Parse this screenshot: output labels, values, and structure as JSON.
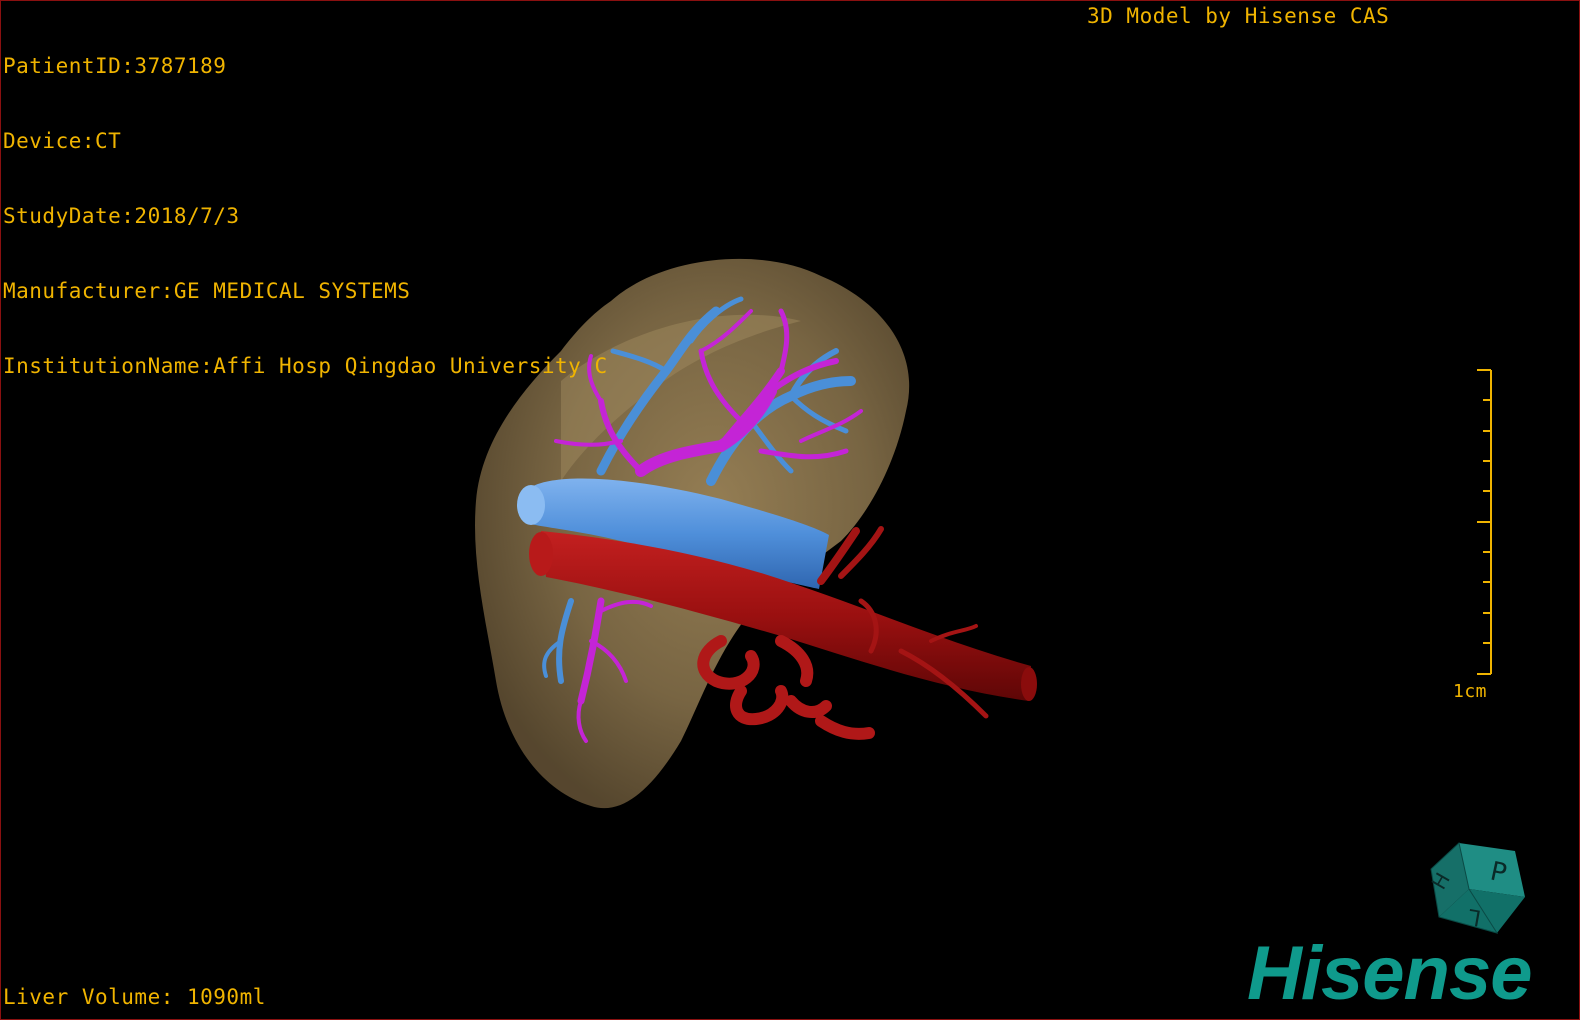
{
  "patient_info": {
    "patient_id": "PatientID:3787189",
    "device": "Device:CT",
    "study_date": "StudyDate:2018/7/3",
    "manufacturer": "Manufacturer:GE MEDICAL SYSTEMS",
    "institution": "InstitutionName:Affi Hosp Qingdao University C"
  },
  "model_credit": "3D Model by Hisense CAS",
  "liver_volume": "Liver Volume: 1090ml",
  "scale_bar": {
    "label": "1cm"
  },
  "orientation_cube": {
    "labels": [
      "P",
      "H",
      "L"
    ]
  },
  "brand": {
    "name": "Hisense"
  },
  "colors": {
    "overlay_text": "#f0b400",
    "liver": "#8a7450",
    "portal_vein": "#c424d6",
    "hepatic_vein": "#4a8fd8",
    "artery": "#a41414",
    "brand": "#0f9a8c",
    "border": "#8a1010"
  }
}
